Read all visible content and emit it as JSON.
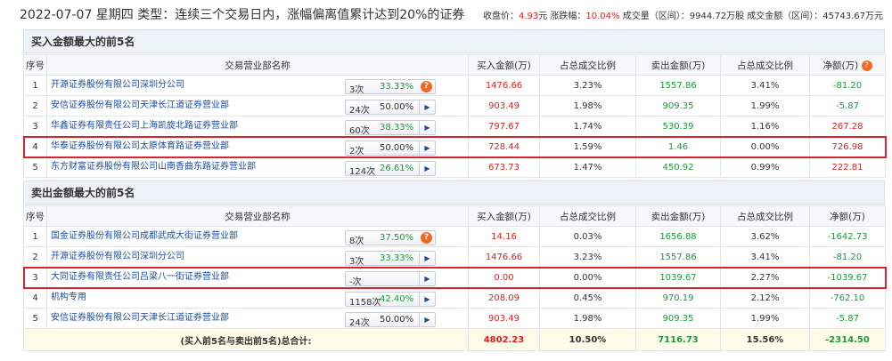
{
  "header": {
    "title": "2022-07-07 星期四 类型：连续三个交易日内，涨幅偏离值累计达到20%的证券",
    "close_label": "收盘价：",
    "close_value": "4.93",
    "close_unit": "元",
    "change_label": "涨跌幅：",
    "change_value": "10.04%",
    "volume_label": "成交量（区间）：",
    "volume_value": "9944.72万股",
    "amount_label": "成交金额（区间）：",
    "amount_value": "45743.67万元"
  },
  "columns": {
    "seq": "序号",
    "org": "交易营业部名称",
    "buy": "买入金额(万)",
    "buy_ratio": "占总成交比例",
    "sell": "卖出金额(万)",
    "sell_ratio": "占总成交比例",
    "net": "净额(万)"
  },
  "buy_section": {
    "title": "买入金额最大的前5名",
    "rows": [
      {
        "seq": "1",
        "org": "开源证券股份有限公司深圳分公司",
        "count": "3次",
        "pct": "33.33%",
        "pct_color": "green",
        "badge": "question",
        "buy": "1476.66",
        "buy_ratio": "3.23%",
        "sell": "1557.86",
        "sell_ratio": "3.41%",
        "net": "-81.20",
        "net_sign": "neg"
      },
      {
        "seq": "2",
        "org": "安信证券股份有限公司天津长江道证券营业部",
        "count": "24次",
        "pct": "50.00%",
        "pct_color": "normal",
        "badge": "arrow",
        "buy": "903.49",
        "buy_ratio": "1.98%",
        "sell": "909.35",
        "sell_ratio": "1.99%",
        "net": "-5.87",
        "net_sign": "neg"
      },
      {
        "seq": "3",
        "org": "华鑫证券有限责任公司上海凯旋北路证券营业部",
        "count": "60次",
        "pct": "38.33%",
        "pct_color": "green",
        "badge": "arrow",
        "buy": "797.67",
        "buy_ratio": "1.74%",
        "sell": "530.39",
        "sell_ratio": "1.16%",
        "net": "267.28",
        "net_sign": "pos"
      },
      {
        "seq": "4",
        "org": "华泰证券股份有限公司太原体育路证券营业部",
        "count": "2次",
        "pct": "50.00%",
        "pct_color": "normal",
        "badge": "arrow",
        "buy": "728.44",
        "buy_ratio": "1.59%",
        "sell": "1.46",
        "sell_ratio": "0.00%",
        "net": "726.98",
        "net_sign": "pos",
        "highlight": true
      },
      {
        "seq": "5",
        "org": "东方财富证券股份有限公司山南香曲东路证券营业部",
        "count": "124次",
        "pct": "26.61%",
        "pct_color": "green",
        "badge": "arrow",
        "buy": "673.73",
        "buy_ratio": "1.47%",
        "sell": "450.92",
        "sell_ratio": "0.99%",
        "net": "222.81",
        "net_sign": "pos"
      }
    ]
  },
  "sell_section": {
    "title": "卖出金额最大的前5名",
    "rows": [
      {
        "seq": "1",
        "org": "国金证券股份有限公司成都武成大街证券营业部",
        "count": "8次",
        "pct": "37.50%",
        "pct_color": "green",
        "badge": "question",
        "buy": "14.16",
        "buy_ratio": "0.03%",
        "sell": "1656.88",
        "sell_ratio": "3.62%",
        "net": "-1642.73",
        "net_sign": "neg"
      },
      {
        "seq": "2",
        "org": "开源证券股份有限公司深圳分公司",
        "count": "3次",
        "pct": "33.33%",
        "pct_color": "green",
        "badge": "arrow",
        "buy": "1476.66",
        "buy_ratio": "3.23%",
        "sell": "1557.86",
        "sell_ratio": "3.41%",
        "net": "-81.20",
        "net_sign": "neg"
      },
      {
        "seq": "3",
        "org": "大同证券有限责任公司吕梁八一街证券营业部",
        "count": "-次",
        "pct": "",
        "pct_color": "normal",
        "badge": "arrow",
        "buy": "0.00",
        "buy_ratio": "0.00%",
        "sell": "1039.67",
        "sell_ratio": "2.27%",
        "net": "-1039.67",
        "net_sign": "neg",
        "highlight": true
      },
      {
        "seq": "4",
        "org": "机构专用",
        "count": "1158次",
        "pct": "42.40%",
        "pct_color": "green",
        "badge": "arrow",
        "buy": "208.09",
        "buy_ratio": "0.45%",
        "sell": "970.19",
        "sell_ratio": "2.12%",
        "net": "-762.10",
        "net_sign": "neg"
      },
      {
        "seq": "5",
        "org": "安信证券股份有限公司天津长江道证券营业部",
        "count": "24次",
        "pct": "50.00%",
        "pct_color": "normal",
        "badge": "arrow",
        "buy": "903.49",
        "buy_ratio": "1.98%",
        "sell": "909.35",
        "sell_ratio": "1.99%",
        "net": "-5.87",
        "net_sign": "neg"
      }
    ],
    "total": {
      "label": "(买入前5名与卖出前5名)",
      "label_bold": "总合计:",
      "buy": "4802.23",
      "buy_ratio": "10.50%",
      "sell": "7116.73",
      "sell_ratio": "15.56%",
      "net": "-2314.50"
    }
  },
  "icons": {
    "question": "question-icon",
    "arrow": "triangle-right-icon"
  },
  "colors": {
    "up": "#e02020",
    "down": "#1a9a3a",
    "link": "#1a4da3",
    "highlight": "#d9232d"
  }
}
